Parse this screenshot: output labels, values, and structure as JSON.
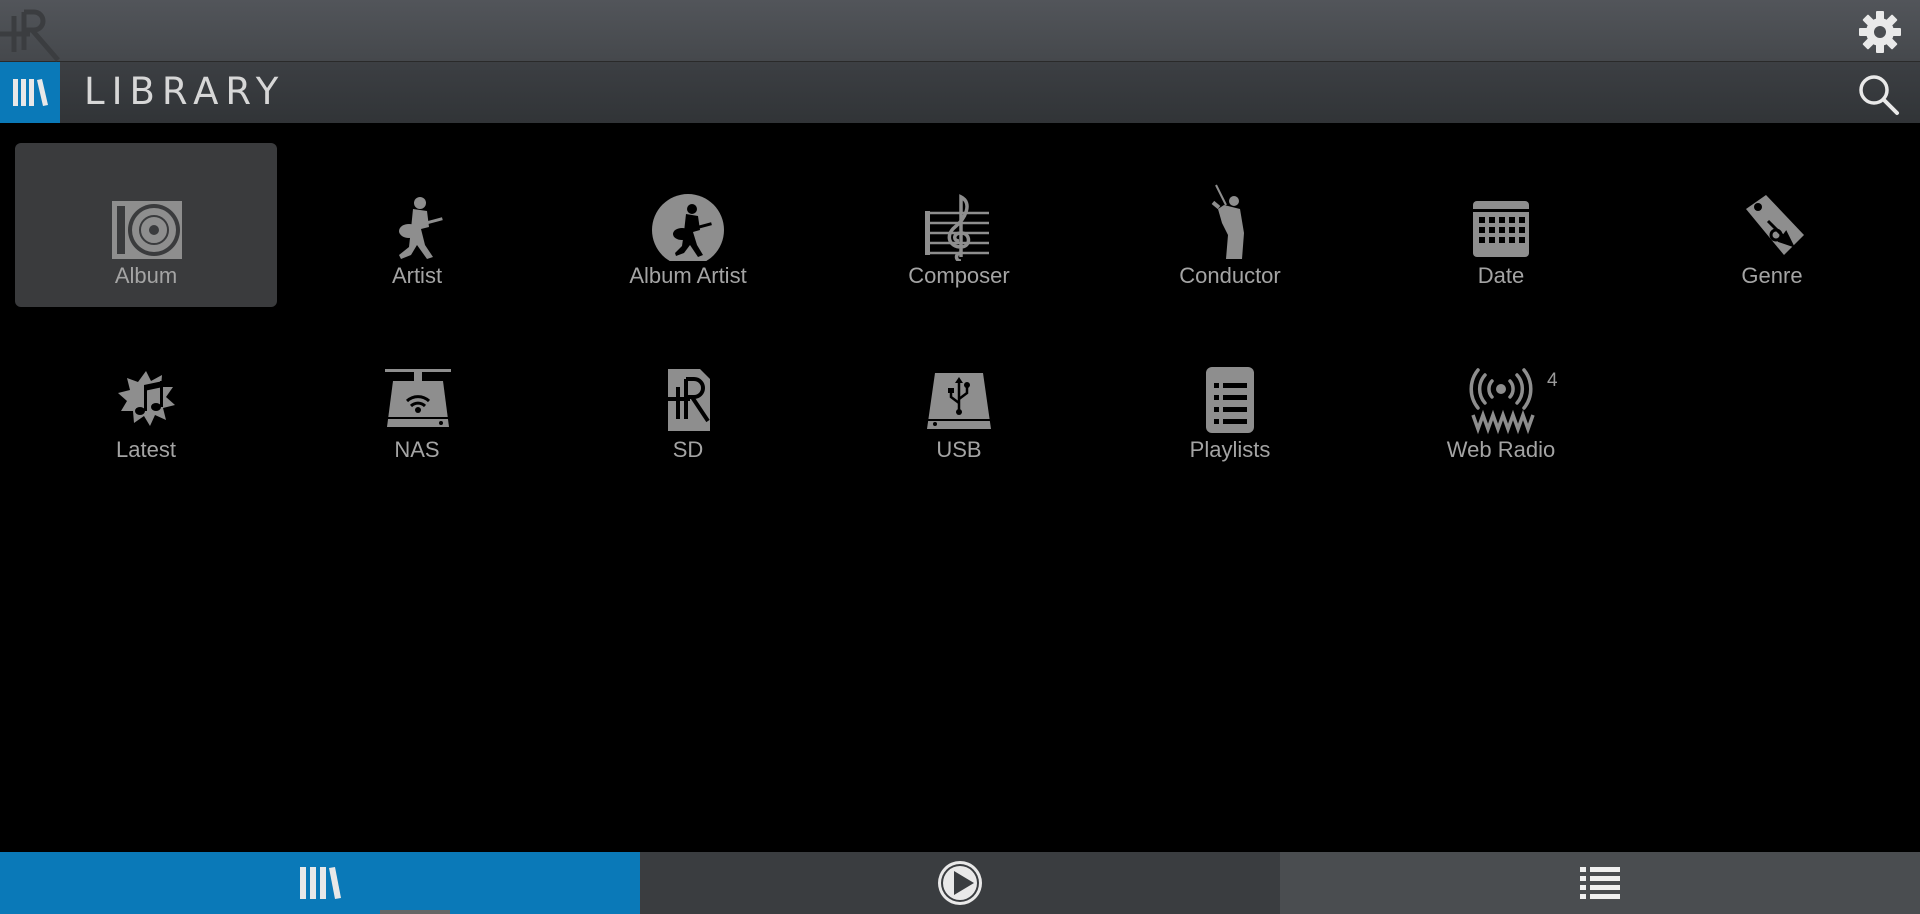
{
  "colors": {
    "accent": "#0a79b8",
    "icon": "#8e8e8e",
    "selected_bg": "#3a3b3d"
  },
  "topbar": {
    "logo_icon": "rk-logo-icon",
    "settings_icon": "gear-icon"
  },
  "header": {
    "title": "LIBRARY",
    "left_icon": "library-books-icon",
    "search_icon": "search-icon"
  },
  "categories": [
    {
      "label": "Album",
      "icon": "album-disc-icon",
      "selected": true
    },
    {
      "label": "Artist",
      "icon": "guitarist-icon",
      "selected": false
    },
    {
      "label": "Album Artist",
      "icon": "guitarist-circle-icon",
      "selected": false
    },
    {
      "label": "Composer",
      "icon": "treble-clef-icon",
      "selected": false
    },
    {
      "label": "Conductor",
      "icon": "conductor-icon",
      "selected": false
    },
    {
      "label": "Date",
      "icon": "calendar-icon",
      "selected": false
    },
    {
      "label": "Genre",
      "icon": "tag-trumpet-icon",
      "selected": false
    },
    {
      "label": "Latest",
      "icon": "starburst-note-icon",
      "selected": false
    },
    {
      "label": "NAS",
      "icon": "nas-drive-icon",
      "selected": false
    },
    {
      "label": "SD",
      "icon": "sd-card-icon",
      "selected": false
    },
    {
      "label": "USB",
      "icon": "usb-drive-icon",
      "selected": false
    },
    {
      "label": "Playlists",
      "icon": "playlist-doc-icon",
      "selected": false
    },
    {
      "label": "Web Radio",
      "icon": "web-radio-icon",
      "selected": false,
      "count": "4"
    }
  ],
  "bottom_nav": [
    {
      "name": "library",
      "icon": "library-books-icon",
      "active": true
    },
    {
      "name": "now-playing",
      "icon": "play-circle-icon",
      "active": false
    },
    {
      "name": "queue",
      "icon": "list-icon",
      "active": false
    }
  ]
}
